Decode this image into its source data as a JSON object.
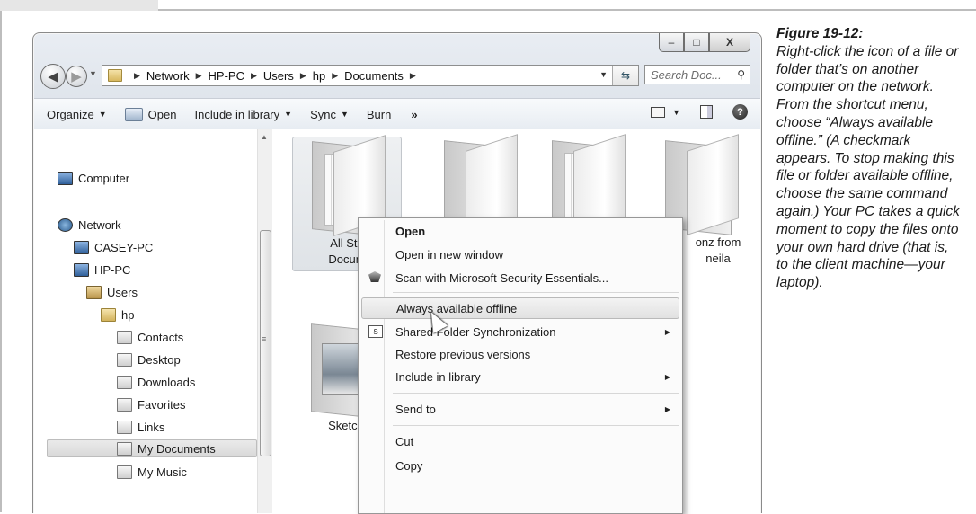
{
  "window": {
    "controls": [
      "–",
      "□",
      "X"
    ],
    "breadcrumbs": [
      "Network",
      "HP-PC",
      "Users",
      "hp",
      "Documents"
    ],
    "search_placeholder": "Search Doc..."
  },
  "toolbar": {
    "organize": "Organize",
    "open": "Open",
    "include_in_library": "Include in library",
    "sync": "Sync",
    "burn": "Burn",
    "more": "»"
  },
  "nav": {
    "computer": "Computer",
    "network": "Network",
    "casey_pc": "CASEY-PC",
    "hp_pc": "HP-PC",
    "users": "Users",
    "hp": "hp",
    "contacts": "Contacts",
    "desktop": "Desktop",
    "downloads": "Downloads",
    "favorites": "Favorites",
    "links": "Links",
    "my_documents": "My Documents",
    "my_music": "My Music"
  },
  "files": {
    "all_stories_line1": "All Sto",
    "all_stories_line2": "Docum",
    "sketch": "Sketch",
    "oonz_line1": "onz from",
    "oonz_line2": "neila"
  },
  "context_menu": {
    "open": "Open",
    "open_new_window": "Open in new window",
    "scan": "Scan with Microsoft Security Essentials...",
    "always_offline": "Always available offline",
    "shared_sync": "Shared Folder Synchronization",
    "restore": "Restore previous versions",
    "include_library": "Include in library",
    "send_to": "Send to",
    "cut": "Cut",
    "copy": "Copy"
  },
  "caption": {
    "figure": "Figure 19-12:",
    "text": "Right-click the icon of a file or folder that’s on another computer on the network. From the shortcut menu, choose “Always available offline.” (A checkmark appears. To stop making this file or folder available offline, choose the same command again.) Your PC takes a quick moment to copy the files onto your own hard drive (that is, to the client machine—your laptop)."
  }
}
